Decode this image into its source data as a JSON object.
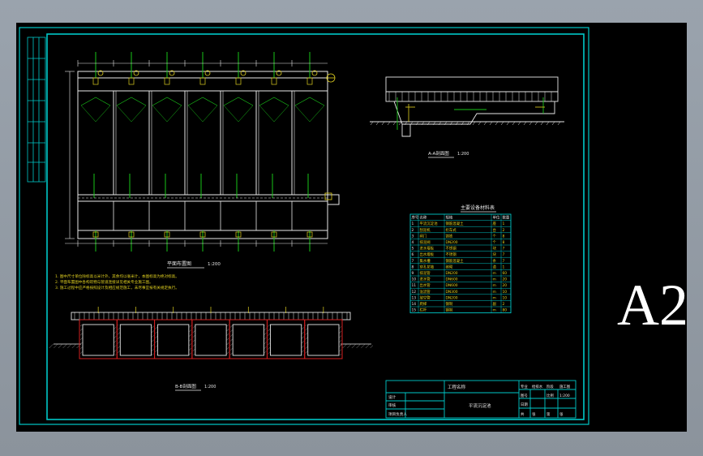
{
  "sheet": {
    "size_label": "A2",
    "border_color": "#00c8c8",
    "line_color": "#e8e8e8",
    "accent_green": "#19c419",
    "accent_red": "#d42020",
    "accent_yellow": "#e0d020"
  },
  "plan": {
    "title": "平面布置图",
    "scale": "1:200",
    "bay_count": 7
  },
  "notes": {
    "lines": [
      "1. 图中尺寸单位除标高以米计外，其余均以毫米计，本图标高为绝对标高。",
      "2. 平面布置图中各构筑物与管道连接详见相关专业施工图。",
      "3. 施工过程中应严格按照设计及相应规范施工，未尽事宜按有关规定执行。"
    ]
  },
  "section_aa": {
    "title": "A-A剖面图",
    "scale": "1:200"
  },
  "section_bb": {
    "title": "B-B剖面图",
    "scale": "1:200"
  },
  "equipment_table": {
    "title": "主要设备材料表",
    "headers": [
      "序号",
      "名称",
      "规格",
      "单位",
      "数量"
    ],
    "rows": [
      [
        "1",
        "平流沉淀池",
        "钢筋混凝土",
        "座",
        "1"
      ],
      [
        "2",
        "刮泥机",
        "桁车式",
        "台",
        "2"
      ],
      [
        "3",
        "闸门",
        "铸铁",
        "个",
        "8"
      ],
      [
        "4",
        "排泥阀",
        "DN200",
        "个",
        "8"
      ],
      [
        "5",
        "进水堰板",
        "不锈钢",
        "块",
        "7"
      ],
      [
        "6",
        "出水堰板",
        "不锈钢",
        "块",
        "7"
      ],
      [
        "7",
        "集水槽",
        "钢筋混凝土",
        "条",
        "7"
      ],
      [
        "8",
        "穿孔花墙",
        "砖砌",
        "道",
        "1"
      ],
      [
        "9",
        "排泥管",
        "DN200",
        "m",
        "60"
      ],
      [
        "10",
        "进水管",
        "DN600",
        "m",
        "20"
      ],
      [
        "11",
        "出水管",
        "DN600",
        "m",
        "20"
      ],
      [
        "12",
        "溢流管",
        "DN300",
        "m",
        "10"
      ],
      [
        "13",
        "放空管",
        "DN200",
        "m",
        "10"
      ],
      [
        "14",
        "爬梯",
        "钢制",
        "副",
        "2"
      ],
      [
        "15",
        "栏杆",
        "钢制",
        "m",
        "80"
      ]
    ]
  },
  "title_block": {
    "project_label": "工程名称",
    "drawing_name": "平流沉淀池",
    "left_labels": [
      "设计",
      "审核",
      "项目负责人"
    ],
    "right_rows": [
      [
        "专业",
        "给排水",
        "阶段",
        "施工图"
      ],
      [
        "图号",
        "",
        "比例",
        "1:200"
      ],
      [
        "日期",
        "",
        "",
        ""
      ],
      [
        "共",
        "张",
        "第",
        "张"
      ]
    ]
  }
}
